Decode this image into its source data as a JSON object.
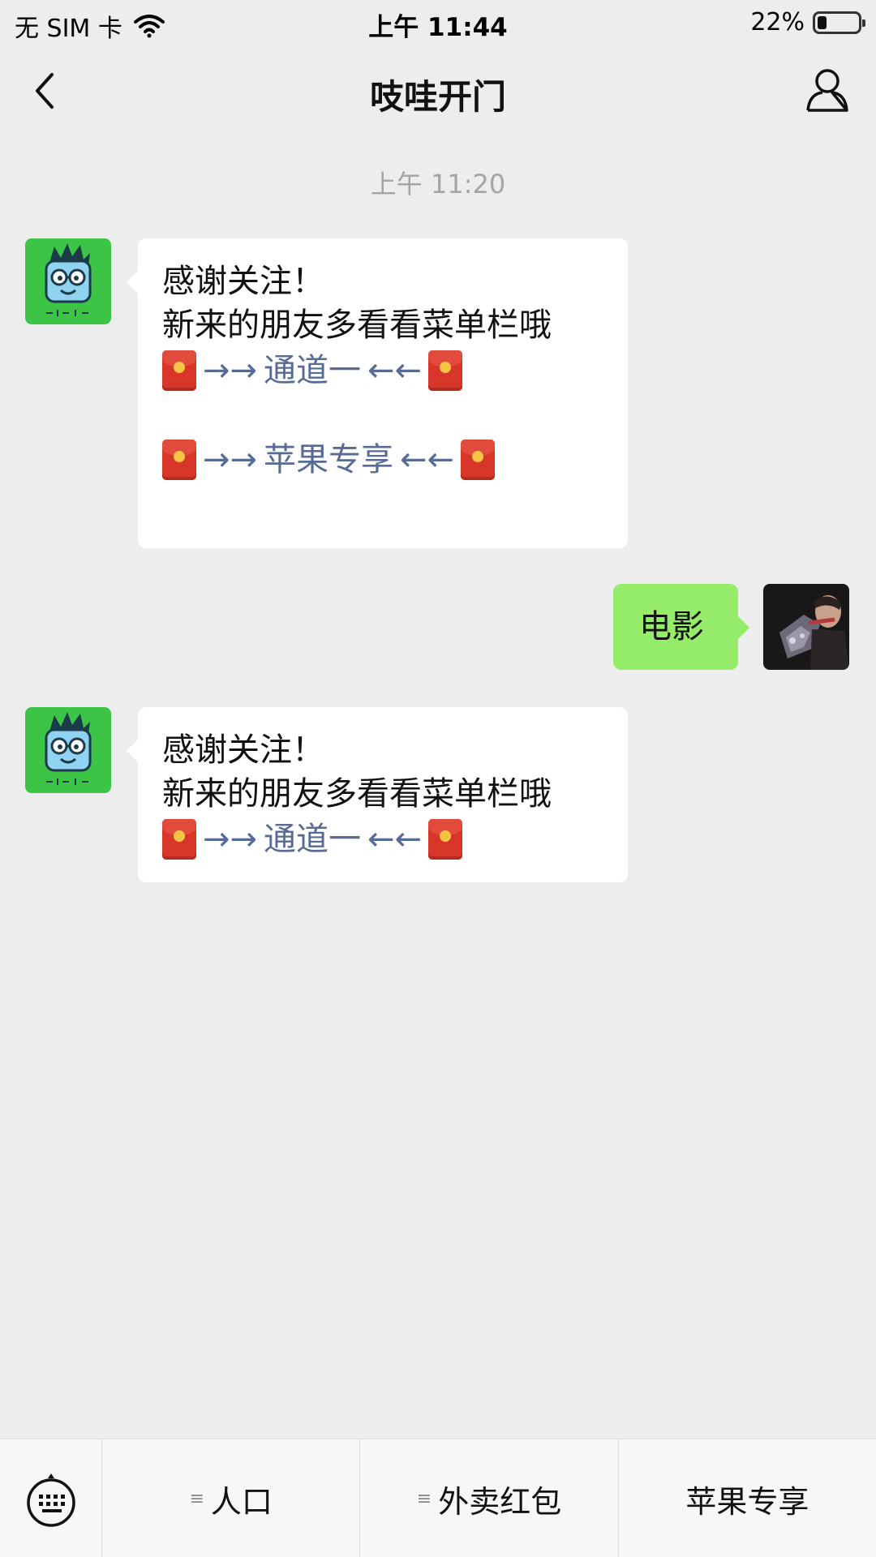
{
  "status_bar": {
    "carrier": "无 SIM 卡",
    "time": "上午 11:44",
    "battery": "22%",
    "battery_level": 0.22
  },
  "nav": {
    "title": "吱哇开门",
    "back_icon": "chevron-left-icon",
    "profile_icon": "person-icon"
  },
  "timestamp": "上午 11:20",
  "messages": [
    {
      "line1": "感谢关注！",
      "line2": "新来的朋友多看看菜单栏哦",
      "link1": "通道一",
      "link2": "苹果专享"
    },
    {
      "text": "电影"
    },
    {
      "line1": "感谢关注！",
      "line2": "新来的朋友多看看菜单栏哦",
      "link1": "通道一"
    }
  ],
  "arrows": {
    "right": "→→",
    "left": "←←"
  },
  "bottom_menu": {
    "keyboard_icon": "keyboard-icon",
    "items": [
      {
        "label": "人口",
        "has_submenu": true
      },
      {
        "label": "外卖红包",
        "has_submenu": true
      },
      {
        "label": "苹果专享",
        "has_submenu": false
      }
    ],
    "submenu_marker": "≡"
  },
  "colors": {
    "background": "#ededed",
    "outgoing_bubble": "#95ec69",
    "link": "#576b95",
    "avatar_bg": "#3cc447"
  }
}
